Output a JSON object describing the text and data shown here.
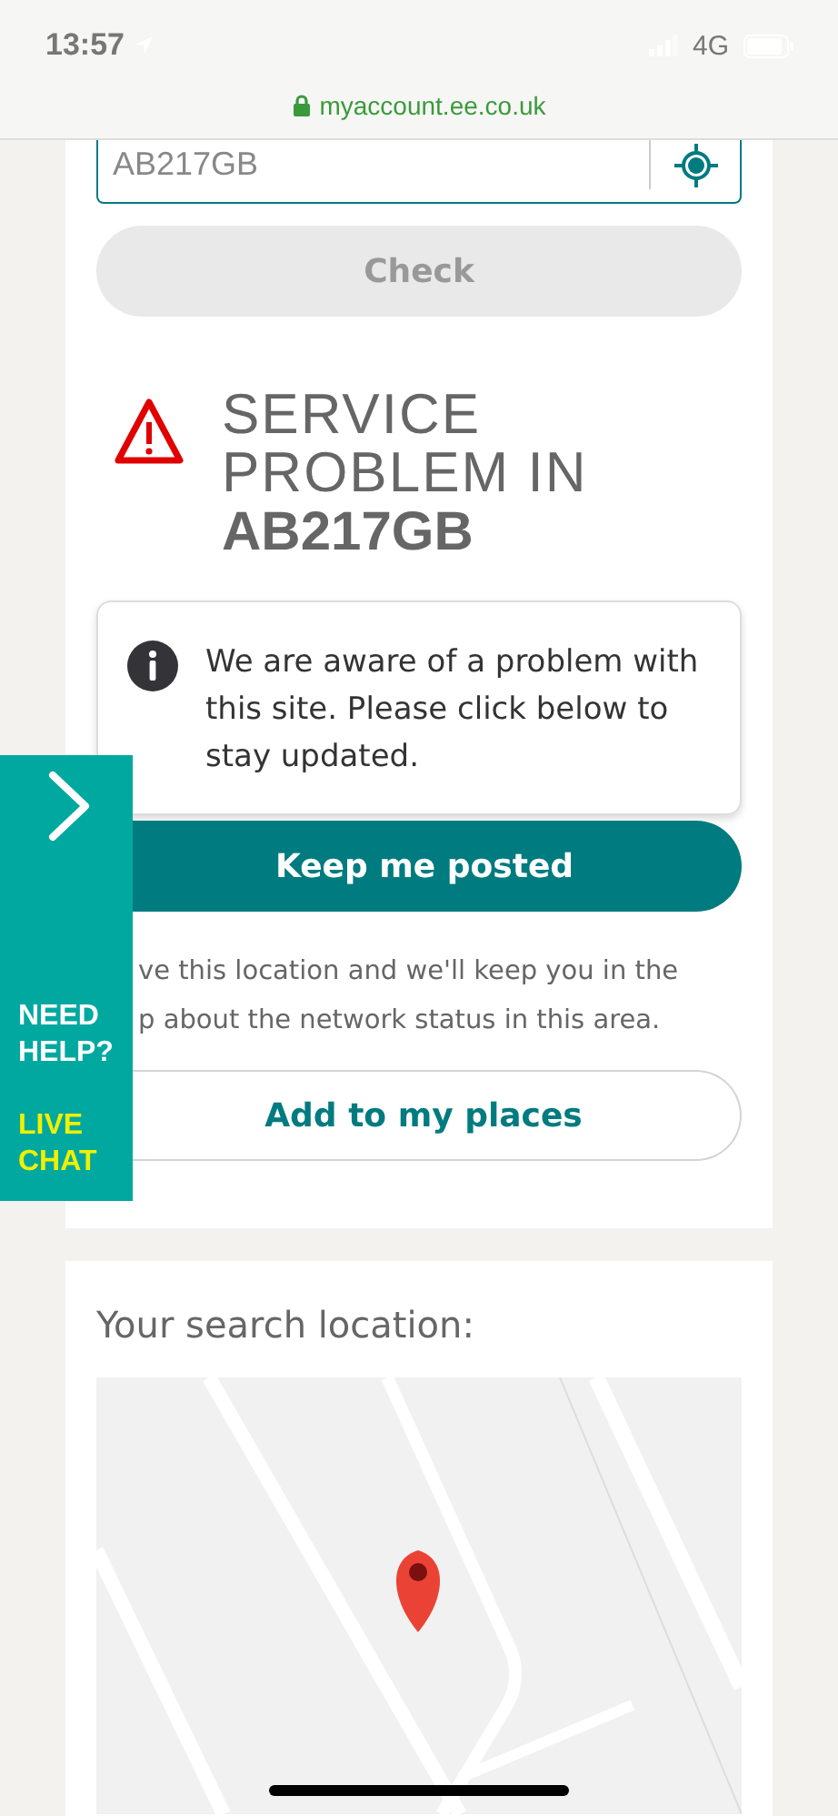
{
  "status_bar": {
    "time": "13:57",
    "network": "4G"
  },
  "browser": {
    "url": "myaccount.ee.co.uk"
  },
  "postcode_field": {
    "value": "AB217GB"
  },
  "check_button": {
    "label": "Check",
    "disabled": true
  },
  "alert": {
    "title_lines": [
      "SERVICE",
      "PROBLEM IN"
    ],
    "postcode": "AB217GB"
  },
  "notice": {
    "text": "We are aware of a problem with this site. Please click below to stay updated."
  },
  "keep_button": {
    "label": "Keep me posted"
  },
  "save_text": [
    "ve this location and we'll keep you in the",
    "p about the network status in this area."
  ],
  "places_button": {
    "label": "Add to my places"
  },
  "help_panel": {
    "heading": [
      "NEED",
      "HELP?"
    ],
    "link": [
      "LIVE",
      "CHAT"
    ]
  },
  "location": {
    "heading": "Your search location:"
  }
}
